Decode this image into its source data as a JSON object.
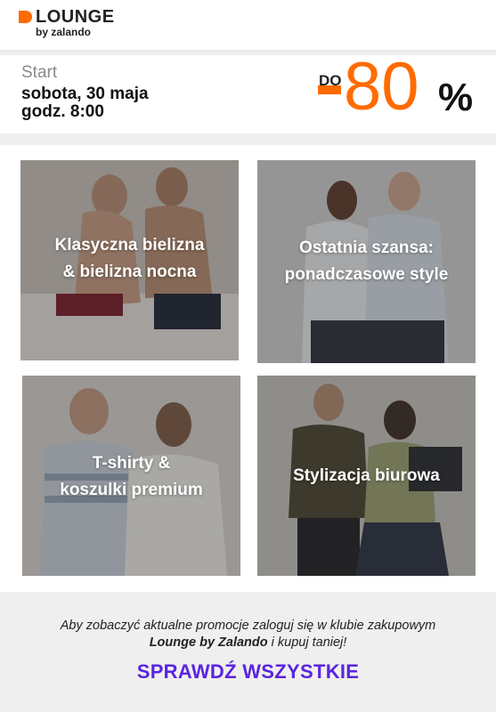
{
  "header": {
    "logo_name": "LOUNGE",
    "logo_sub": "by zalando",
    "brand_color": "#ff6b00"
  },
  "banner": {
    "start_label": "Start",
    "date": "sobota, 30 maja",
    "time": "godz. 8:00",
    "promo_prefix": "DO",
    "promo_value": "80",
    "promo_unit": "%",
    "accent_color": "#ff6b00"
  },
  "categories": [
    {
      "line1": "Klasyczna bielizna",
      "line2": "& bielizna nocna"
    },
    {
      "line1": "Ostatnia szansa:",
      "line2": "ponadczasowe style"
    },
    {
      "line1": "T-shirty &",
      "line2": "koszulki premium"
    },
    {
      "line1": "Stylizacja biurowa",
      "line2": ""
    }
  ],
  "footer": {
    "notice_line1": "Aby zobaczyć aktualne promocje zaloguj się w klubie zakupowym",
    "notice_brand": "Lounge by Zalando",
    "notice_rest": " i kupuj taniej!",
    "cta_label": "SPRAWDŹ WSZYSTKIE",
    "cta_color": "#5a24e0"
  }
}
